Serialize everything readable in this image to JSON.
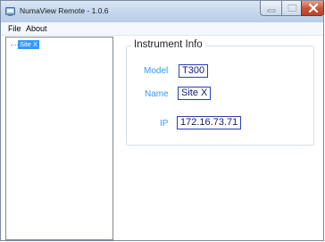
{
  "window": {
    "title": "NumaView Remote - 1.0.6"
  },
  "menu": {
    "items": [
      "File",
      "About"
    ]
  },
  "tree": {
    "nodes": [
      "Site X"
    ]
  },
  "instrument_info": {
    "title": "Instrument Info",
    "model_label": "Model",
    "model_value": "T300",
    "name_label": "Name",
    "name_value": "Site X",
    "ip_label": "IP",
    "ip_value": "172.16.73.71"
  },
  "colors": {
    "label_blue": "#3399ff",
    "value_border": "#2b3fb5",
    "selection": "#3399ff"
  },
  "icons": {
    "app": "app-icon",
    "minimize": "minimize-icon",
    "maximize": "maximize-icon",
    "close": "close-icon"
  }
}
